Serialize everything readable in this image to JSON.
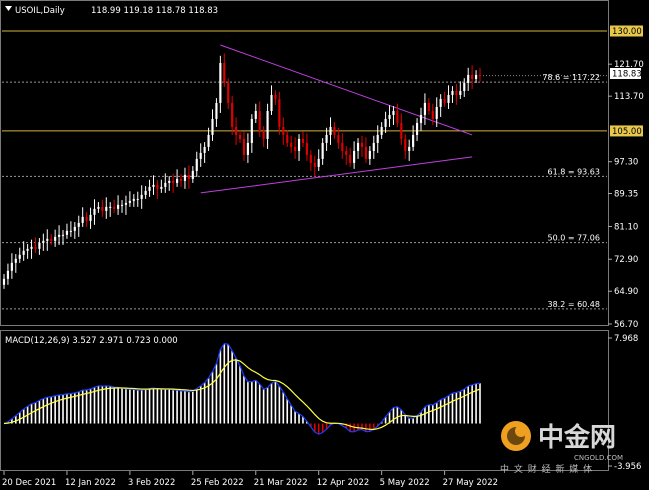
{
  "header": {
    "symbol": "USOIL,Daily",
    "ohlc": "118.99 119.18 118.78 118.83",
    "menu_icon": "triangle-down-icon"
  },
  "colors": {
    "background": "#000000",
    "bull": "#ffffff",
    "bear": "#e00000",
    "level_line": "#d4b43a",
    "fib_line": "#9a9a9a",
    "triangle": "#c040e0",
    "macd_line": "#1a3cff",
    "signal_line": "#ffff40",
    "hist_pos": "#ffffff",
    "hist_neg": "#e00000"
  },
  "chart_data": [
    {
      "type": "candlestick",
      "series_name": "USOIL,Daily",
      "y_ticks": [
        "130.00",
        "121.70",
        "113.70",
        "105.00",
        "97.30",
        "89.35",
        "81.10",
        "72.90",
        "64.90",
        "56.70"
      ],
      "y_tick_values": [
        130.0,
        121.7,
        113.7,
        105.0,
        97.3,
        89.35,
        81.1,
        72.9,
        64.9,
        56.7
      ],
      "ylim": [
        56.7,
        132.5
      ],
      "x_ticks": [
        "20 Dec 2021",
        "12 Jan 2022",
        "3 Feb 2022",
        "25 Feb 2022",
        "21 Mar 2022",
        "12 Apr 2022",
        "5 May 2022",
        "27 May 2022"
      ],
      "horizontal_levels": [
        {
          "value": 130.0,
          "label": "130.00"
        },
        {
          "value": 105.0,
          "label": "105.00"
        }
      ],
      "fib_levels": [
        {
          "label": "78.6 = 117.22",
          "value": 117.22
        },
        {
          "label": "61.8 = 93.63",
          "value": 93.63
        },
        {
          "label": "50.0 = 77.06",
          "value": 77.06
        },
        {
          "label": "38.2 = 60.48",
          "value": 60.48
        }
      ],
      "current_price": "118.83",
      "current_price_value": 118.83,
      "triangle": {
        "upper": [
          [
            "25 Feb 2022",
            126.5
          ],
          [
            "2 Jun 2022",
            104.0
          ]
        ],
        "lower": [
          [
            "18 Feb 2022",
            89.5
          ],
          [
            "2 Jun 2022",
            98.5
          ]
        ]
      },
      "closes": [
        68,
        70,
        72,
        73,
        74,
        75,
        75.5,
        76,
        75.5,
        77,
        77.5,
        78,
        77.5,
        78.5,
        79,
        79,
        80,
        80,
        81,
        82,
        83.5,
        82.5,
        84,
        85.5,
        86,
        85,
        86,
        86,
        85.5,
        86.5,
        86.5,
        87,
        87.5,
        88,
        88,
        89,
        90,
        91,
        91.5,
        90.5,
        91,
        92,
        92.5,
        92,
        93,
        92.5,
        94,
        93,
        95,
        98,
        99.5,
        101,
        104,
        108,
        112,
        122,
        117,
        112,
        106,
        104,
        103,
        99,
        102,
        108,
        110,
        105,
        103,
        110,
        114,
        113,
        106,
        104,
        102,
        101,
        100,
        103,
        102,
        99,
        97,
        96,
        98,
        102,
        104,
        106,
        104,
        102,
        100,
        99,
        97,
        100,
        102,
        101,
        98,
        100,
        102,
        104,
        106,
        108,
        109,
        110,
        107,
        103,
        100,
        101,
        104,
        107,
        109,
        112,
        110,
        108,
        111,
        113,
        112,
        114,
        115,
        114,
        115,
        117,
        119,
        118,
        119,
        118.83
      ]
    },
    {
      "type": "macd",
      "label": "MACD(12,26,9) 3.527 2.971 0.723 0.000",
      "params": [
        12,
        26,
        9
      ],
      "values": {
        "macd": 3.527,
        "signal": 2.971,
        "histogram": 0.723,
        "zero": 0.0
      },
      "y_ticks": [
        "7.968",
        "-3.956"
      ],
      "y_tick_values": [
        7.968,
        -3.956
      ]
    }
  ],
  "watermark": {
    "title": "中金网",
    "subtitle": "CNGOLD.COM",
    "tagline": "中 文 财 经 新 媒 体"
  }
}
